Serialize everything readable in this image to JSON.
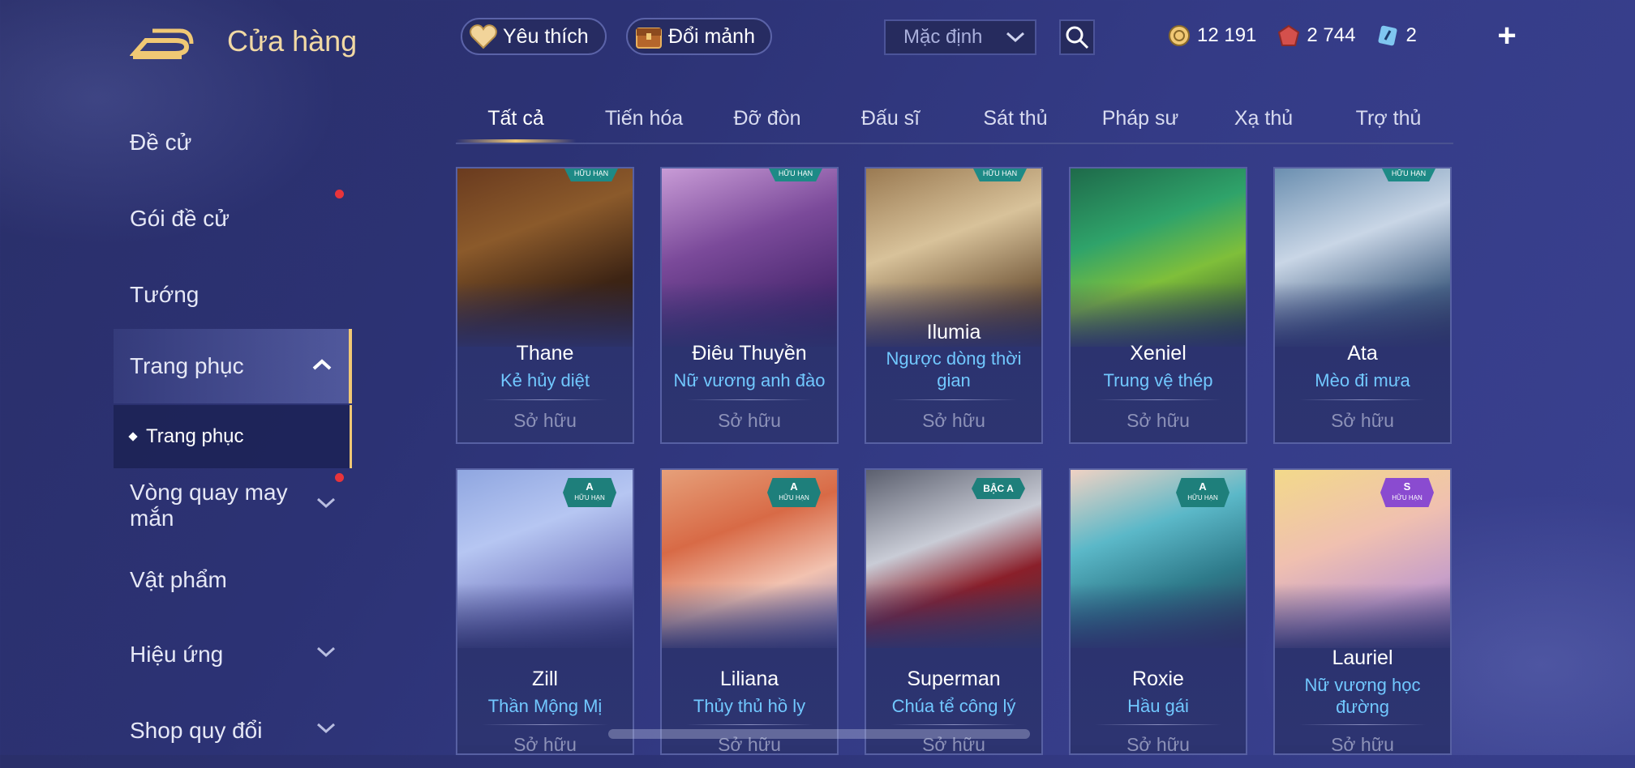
{
  "header": {
    "title": "Cửa hàng",
    "favorite_label": "Yêu thích",
    "exchange_label": "Đổi mảnh",
    "sort_value": "Mặc định",
    "currencies": [
      {
        "icon": "gold-coin-icon",
        "value": "12 191"
      },
      {
        "icon": "ruby-icon",
        "value": "2 744"
      },
      {
        "icon": "voucher-icon",
        "value": "2"
      }
    ]
  },
  "sidebar": {
    "items": [
      {
        "label": "Đề cử"
      },
      {
        "label": "Gói đề cử"
      },
      {
        "label": "Tướng"
      },
      {
        "label": "Trang phục"
      },
      {
        "label": "Vòng quay may mắn"
      },
      {
        "label": "Vật phẩm"
      },
      {
        "label": "Hiệu ứng"
      },
      {
        "label": "Shop quy đổi"
      }
    ],
    "sub_item": "Trang phục"
  },
  "tabs": [
    "Tất cả",
    "Tiến hóa",
    "Đỡ đòn",
    "Đấu sĩ",
    "Sát thủ",
    "Pháp sư",
    "Xạ thủ",
    "Trợ thủ"
  ],
  "cards": [
    {
      "hero": "Thane",
      "skin": "Kẻ hủy diệt",
      "status": "Sở hữu",
      "badge": "HỮU HẠN"
    },
    {
      "hero": "Điêu Thuyền",
      "skin": "Nữ vương anh đào",
      "status": "Sở hữu",
      "badge": "HỮU HẠN"
    },
    {
      "hero": "Ilumia",
      "skin": "Ngược dòng thời gian",
      "status": "Sở hữu",
      "badge": "HỮU HẠN"
    },
    {
      "hero": "Xeniel",
      "skin": "Trung vệ thép",
      "status": "Sở hữu",
      "badge": ""
    },
    {
      "hero": "Ata",
      "skin": "Mèo đi mưa",
      "status": "Sở hữu",
      "badge": "HỮU HẠN"
    },
    {
      "hero": "Zill",
      "skin": "Thần Mộng Mị",
      "status": "Sở hữu",
      "badge": "A",
      "badge_sub": "HỮU HẠN"
    },
    {
      "hero": "Liliana",
      "skin": "Thủy thủ hồ ly",
      "status": "Sở hữu",
      "badge": "A",
      "badge_sub": "HỮU HẠN"
    },
    {
      "hero": "Superman",
      "skin": "Chúa tể công lý",
      "status": "Sở hữu",
      "badge": "BẬC A",
      "badge_sub": ""
    },
    {
      "hero": "Roxie",
      "skin": "Hầu gái",
      "status": "Sở hữu",
      "badge": "A",
      "badge_sub": "HỮU HẠN"
    },
    {
      "hero": "Lauriel",
      "skin": "Nữ vương học đường",
      "status": "Sở hữu",
      "badge": "S",
      "badge_sub": "HỮU HẠN"
    }
  ],
  "colors": {
    "accent_gold": "#f0c874",
    "skin_name": "#71c8ff",
    "notification_dot": "#e8343b"
  }
}
